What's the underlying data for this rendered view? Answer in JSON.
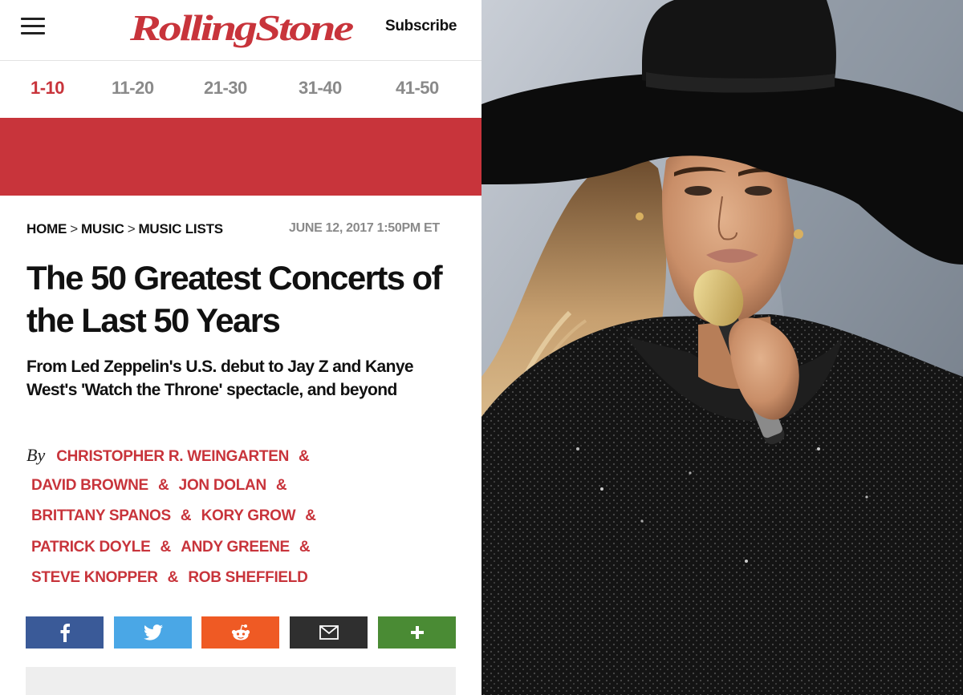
{
  "header": {
    "menu_icon": "hamburger-icon",
    "logo_text": "RollingStone",
    "subscribe_label": "Subscribe"
  },
  "tabs": [
    {
      "label": "1-10",
      "active": true
    },
    {
      "label": "11-20",
      "active": false
    },
    {
      "label": "21-30",
      "active": false
    },
    {
      "label": "31-40",
      "active": false
    },
    {
      "label": "41-50",
      "active": false
    }
  ],
  "breadcrumb": {
    "items": [
      "HOME",
      "MUSIC",
      "MUSIC LISTS"
    ],
    "separator": ">"
  },
  "article": {
    "date": "JUNE 12, 2017 1:50PM ET",
    "title": "The 50 Greatest Concerts of the Last 50 Years",
    "dek": "From Led Zeppelin's U.S. debut to Jay Z and Kanye West's 'Watch the Throne' spectacle, and beyond",
    "by_word": "By",
    "ampersand": "&",
    "authors": [
      "CHRISTOPHER R. WEINGARTEN",
      "DAVID BROWNE",
      "JON DOLAN",
      "BRITTANY SPANOS",
      "KORY GROW",
      "PATRICK DOYLE",
      "ANDY GREENE",
      "STEVE KNOPPER",
      "ROB SHEFFIELD"
    ]
  },
  "share": {
    "buttons": [
      "facebook-icon",
      "twitter-icon",
      "reddit-icon",
      "email-icon",
      "plus-icon"
    ]
  },
  "colors": {
    "brand_red": "#c8343b",
    "tab_inactive": "#8a8a8a",
    "facebook": "#3a5a98",
    "twitter": "#4aa7e6",
    "reddit": "#ef5a24",
    "email": "#2f2f2f",
    "plus": "#4a8b34"
  }
}
